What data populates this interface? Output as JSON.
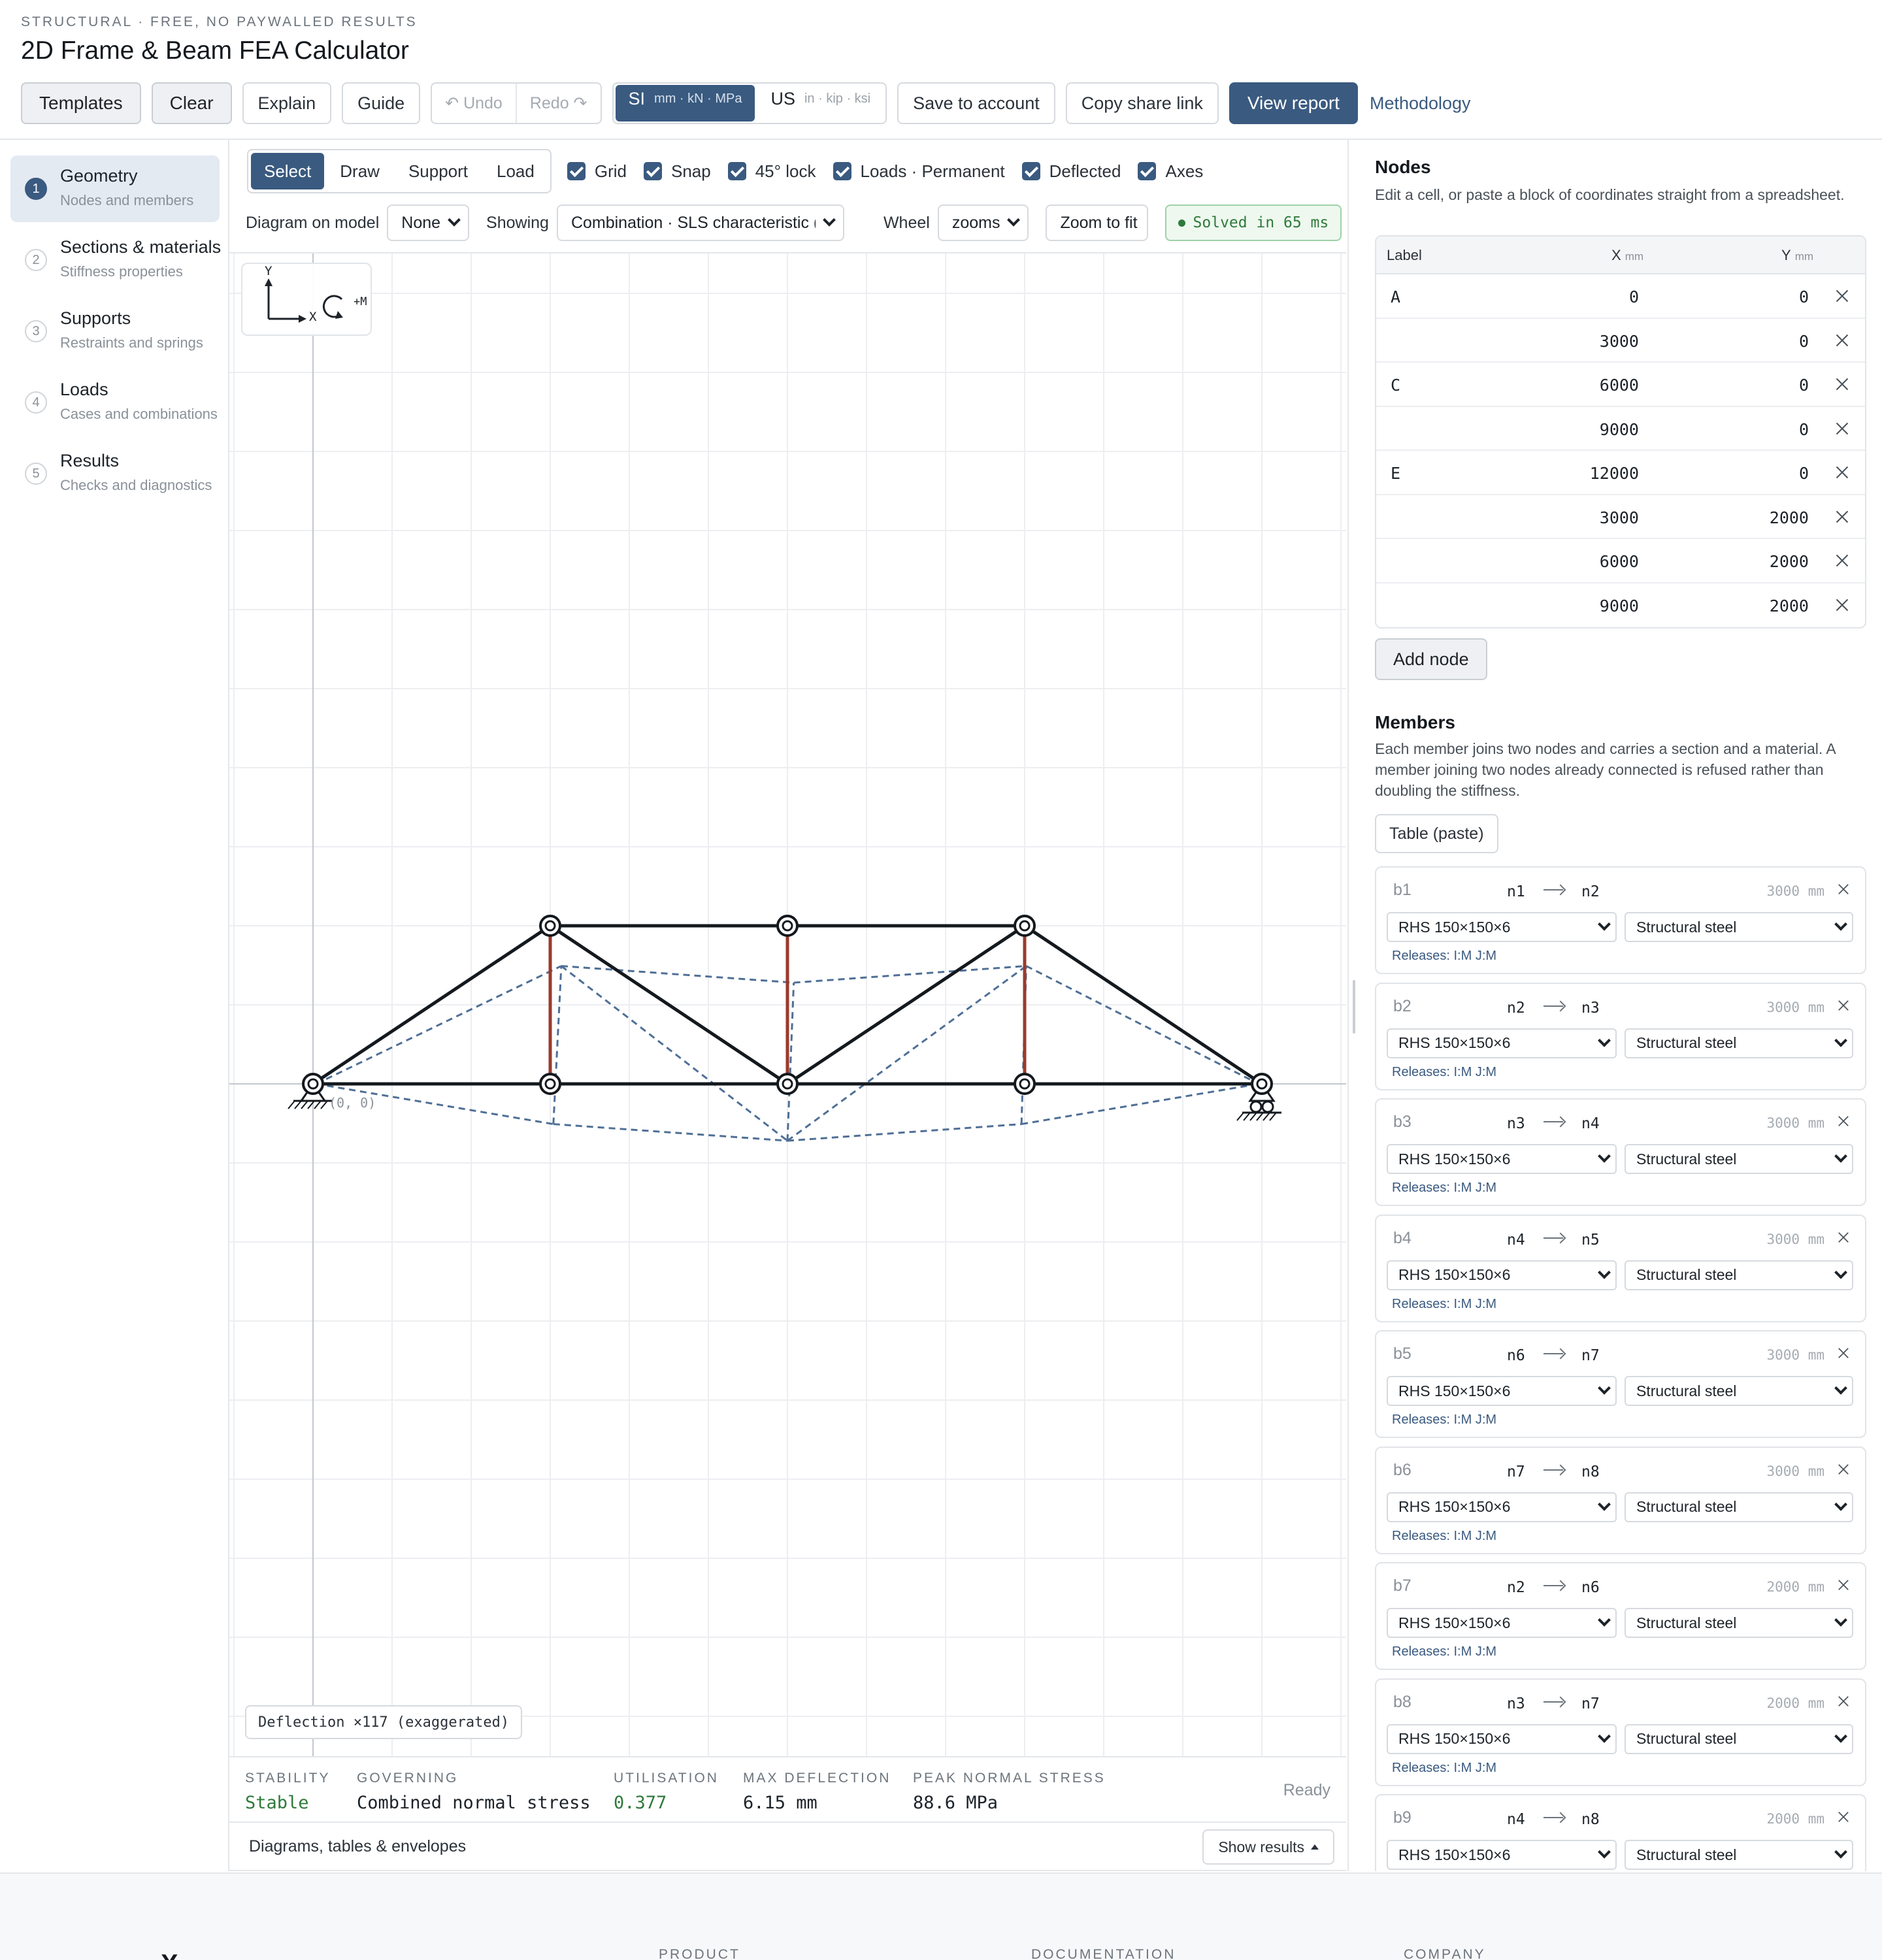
{
  "header": {
    "eyebrow": "STRUCTURAL · FREE, NO PAYWALLED RESULTS",
    "title": "2D Frame & Beam FEA Calculator"
  },
  "toolbar": {
    "templates": "Templates",
    "clear": "Clear",
    "explain": "Explain",
    "guide": "Guide",
    "undo": "↶ Undo",
    "redo": "Redo ↷",
    "unit_si": "SI",
    "unit_si_detail": "mm · kN · MPa",
    "unit_us": "US",
    "unit_us_detail": "in · kip · ksi",
    "save": "Save to account",
    "share": "Copy share link",
    "report": "View report",
    "methodology": "Methodology"
  },
  "steps": [
    {
      "num": "1",
      "label": "Geometry",
      "sub": "Nodes and members"
    },
    {
      "num": "2",
      "label": "Sections & materials",
      "sub": "Stiffness properties"
    },
    {
      "num": "3",
      "label": "Supports",
      "sub": "Restraints and springs"
    },
    {
      "num": "4",
      "label": "Loads",
      "sub": "Cases and combinations"
    },
    {
      "num": "5",
      "label": "Results",
      "sub": "Checks and diagnostics"
    }
  ],
  "canvas_controls": {
    "modes": [
      "Select",
      "Draw",
      "Support",
      "Load"
    ],
    "active_mode": "Select",
    "toggles": [
      "Grid",
      "Snap",
      "45° lock",
      "Loads · Permanent",
      "Deflected",
      "Axes"
    ],
    "diagram_label": "Diagram on model",
    "diagram_value": "None",
    "showing_label": "Showing",
    "showing_value": "Combination · SLS characteristic (",
    "wheel_label": "Wheel",
    "wheel_value": "zooms",
    "zoom_fit": "Zoom to fit",
    "solved": "Solved in 65 ms"
  },
  "canvas": {
    "axis_y": "Y",
    "axis_x": "X",
    "moment": "+M",
    "origin": "(0, 0)",
    "deflection_chip": "Deflection ×117 (exaggerated)",
    "colors": {
      "member": "#14191e",
      "deflected": "#4f6f96",
      "tension": "#9b3a2c",
      "grid": "#eceef1"
    }
  },
  "summary": {
    "stability_k": "STABILITY",
    "stability_v": "Stable",
    "governing_k": "GOVERNING",
    "governing_v": "Combined normal stress",
    "util_k": "UTILISATION",
    "util_v": "0.377",
    "defl_k": "MAX DEFLECTION",
    "defl_v": "6.15 mm",
    "stress_k": "PEAK NORMAL STRESS",
    "stress_v": "88.6 MPa",
    "status": "Ready"
  },
  "diagrams": {
    "title": "Diagrams, tables & envelopes",
    "button": "Show results"
  },
  "nodes": {
    "title": "Nodes",
    "desc": "Edit a cell, or paste a block of coordinates straight from a spreadsheet.",
    "col_label": "Label",
    "col_x": "X",
    "col_y": "Y",
    "unit": "mm",
    "rows": [
      {
        "label": "A",
        "x": "0",
        "y": "0"
      },
      {
        "label": "",
        "x": "3000",
        "y": "0"
      },
      {
        "label": "C",
        "x": "6000",
        "y": "0"
      },
      {
        "label": "",
        "x": "9000",
        "y": "0"
      },
      {
        "label": "E",
        "x": "12000",
        "y": "0"
      },
      {
        "label": "",
        "x": "3000",
        "y": "2000"
      },
      {
        "label": "",
        "x": "6000",
        "y": "2000"
      },
      {
        "label": "",
        "x": "9000",
        "y": "2000"
      }
    ],
    "add": "Add node"
  },
  "members": {
    "title": "Members",
    "desc": "Each member joins two nodes and carries a section and a material. A member joining two nodes already connected is refused rather than doubling the stiffness.",
    "paste": "Table (paste)",
    "items": [
      {
        "id": "b1",
        "from": "n1",
        "to": "n2",
        "len": "3000 mm",
        "section": "RHS 150×150×6",
        "material": "Structural steel",
        "releases": "Releases: I:M J:M"
      },
      {
        "id": "b2",
        "from": "n2",
        "to": "n3",
        "len": "3000 mm",
        "section": "RHS 150×150×6",
        "material": "Structural steel",
        "releases": "Releases: I:M J:M"
      },
      {
        "id": "b3",
        "from": "n3",
        "to": "n4",
        "len": "3000 mm",
        "section": "RHS 150×150×6",
        "material": "Structural steel",
        "releases": "Releases: I:M J:M"
      },
      {
        "id": "b4",
        "from": "n4",
        "to": "n5",
        "len": "3000 mm",
        "section": "RHS 150×150×6",
        "material": "Structural steel",
        "releases": "Releases: I:M J:M"
      },
      {
        "id": "b5",
        "from": "n6",
        "to": "n7",
        "len": "3000 mm",
        "section": "RHS 150×150×6",
        "material": "Structural steel",
        "releases": "Releases: I:M J:M"
      },
      {
        "id": "b6",
        "from": "n7",
        "to": "n8",
        "len": "3000 mm",
        "section": "RHS 150×150×6",
        "material": "Structural steel",
        "releases": "Releases: I:M J:M"
      },
      {
        "id": "b7",
        "from": "n2",
        "to": "n6",
        "len": "2000 mm",
        "section": "RHS 150×150×6",
        "material": "Structural steel",
        "releases": "Releases: I:M J:M"
      },
      {
        "id": "b8",
        "from": "n3",
        "to": "n7",
        "len": "2000 mm",
        "section": "RHS 150×150×6",
        "material": "Structural steel",
        "releases": "Releases: I:M J:M"
      },
      {
        "id": "b9",
        "from": "n4",
        "to": "n8",
        "len": "2000 mm",
        "section": "RHS 150×150×6",
        "material": "Structural steel",
        "releases": ""
      }
    ]
  },
  "footer": {
    "logo": "X",
    "cols": [
      "PRODUCT",
      "DOCUMENTATION",
      "COMPANY"
    ]
  }
}
